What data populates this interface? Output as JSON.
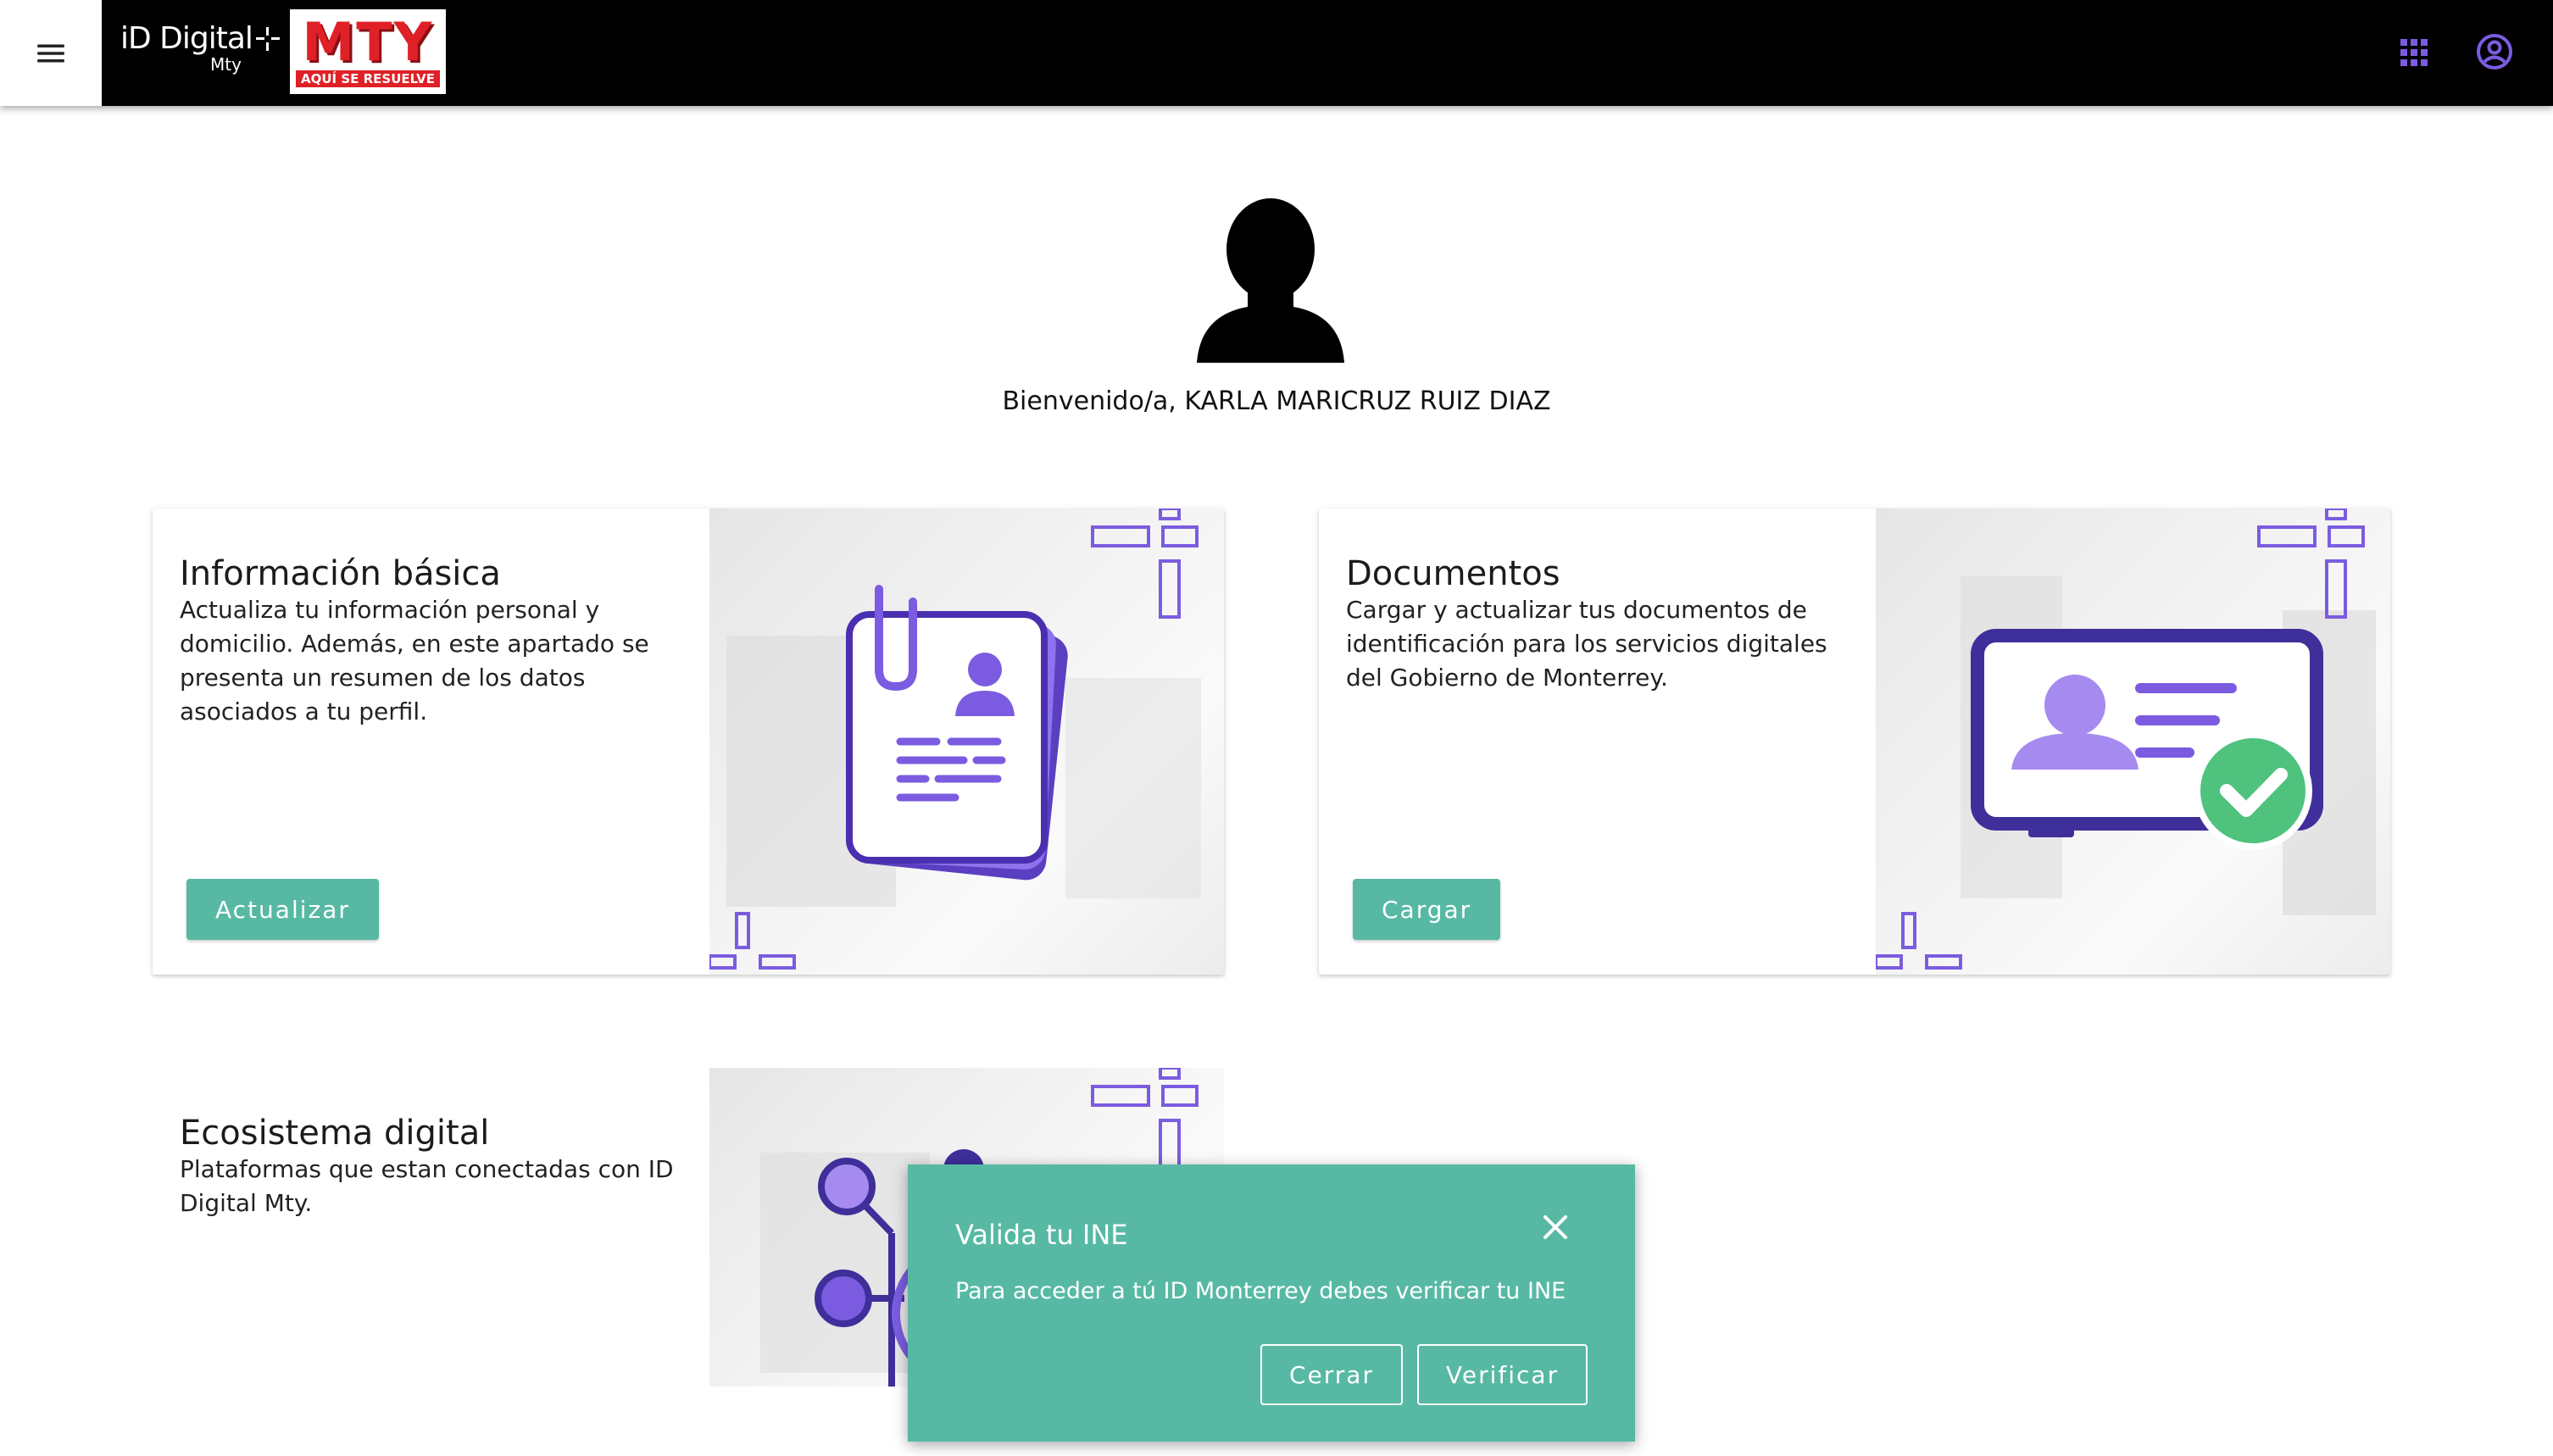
{
  "header": {
    "brand_name": "iD Digital",
    "brand_sub": "Mty",
    "partner_logo_word": "MTY",
    "partner_logo_tagline": "AQUÍ SE RESUELVE",
    "menu_icon": "hamburger-menu-icon",
    "apps_icon": "apps-grid-icon",
    "account_icon": "account-circle-icon"
  },
  "welcome": {
    "text": "Bienvenido/a, KARLA MARICRUZ RUIZ DIAZ"
  },
  "cards": [
    {
      "title": "Información básica",
      "description": "Actualiza tu información personal y domicilio. Además, en este apartado se presenta un resumen de los datos asociados a tu perfil.",
      "button_label": "Actualizar"
    },
    {
      "title": "Documentos",
      "description": "Cargar y actualizar tus documentos de identificación para los servicios digitales del Gobierno de Monterrey.",
      "button_label": "Cargar"
    },
    {
      "title": "Ecosistema digital",
      "description": "Plataformas que estan conectadas con ID Digital Mty."
    }
  ],
  "dialog": {
    "title": "Valida tu INE",
    "message": "Para acceder a tú ID Monterrey debes verificar tu INE",
    "cancel_label": "Cerrar",
    "confirm_label": "Verificar"
  },
  "colors": {
    "accent": "#57b9a4",
    "purple": "#7b5ce0",
    "topbar": "#000000"
  }
}
